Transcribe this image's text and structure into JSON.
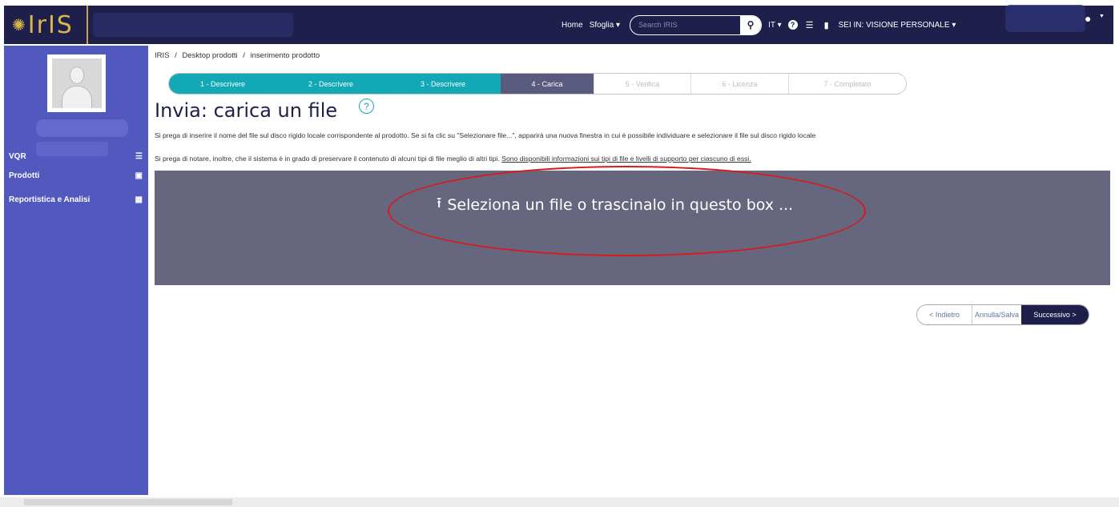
{
  "brand": {
    "logo_text": "IrIS"
  },
  "navbar": {
    "home": "Home",
    "browse": "Sfoglia",
    "browse_caret": "▾",
    "search_placeholder": "Search IRIS",
    "language": "IT",
    "language_caret": "▾",
    "profile_label": "SEI IN: VISIONE PERSONALE",
    "profile_caret": "▾"
  },
  "sidebar": {
    "items": [
      {
        "label": "VQR",
        "icon": "list-icon"
      },
      {
        "label": "Prodotti",
        "icon": "document-icon"
      },
      {
        "label": "Reportistica e Analisi",
        "icon": "table-icon"
      }
    ]
  },
  "breadcrumb": {
    "items": [
      "IRIS",
      "Desktop prodotti",
      "inserimento prodotto"
    ],
    "separator": "/"
  },
  "steps": [
    {
      "label": "1 - Descrivere",
      "state": "done"
    },
    {
      "label": "2 - Descrivere",
      "state": "done"
    },
    {
      "label": "3 - Descrivere",
      "state": "done"
    },
    {
      "label": "4 - Carica",
      "state": "active"
    },
    {
      "label": "5 - Verifica",
      "state": "todo"
    },
    {
      "label": "6 - Licenza",
      "state": "todo"
    },
    {
      "label": "7 - Completato",
      "state": "todo"
    }
  ],
  "page": {
    "title": "Invia: carica un file",
    "help_glyph": "?",
    "info_line1": "Si prega di inserire il nome del file sul disco rigido locale corrispondente al prodotto. Se si fa clic su \"Selezionare file...\", apparirà una nuova finestra in cui è possibile individuare e selezionare il file sul disco rigido locale",
    "info_line2_prefix": "Si prega di notare, inoltre, che il sistema è in grado di preservare il contenuto di alcuni tipi di file meglio di altri tipi.",
    "info_line2_link": "Sono disponibili informazioni sui tipi di file e livelli di supporto per ciascuno di essi.",
    "dropzone_text": "Seleziona un file o trascinalo in questo box ..."
  },
  "buttons": {
    "back": "< Indietro",
    "cancel_save": "Annulla/Salva",
    "next": "Successivo >"
  },
  "colors": {
    "navbar": "#1e1f4a",
    "sidebar": "#5159be",
    "step_done": "#13a8b6",
    "step_active": "#5a5a7e",
    "dropzone": "#66667f",
    "annotation": "#d91a1a"
  }
}
